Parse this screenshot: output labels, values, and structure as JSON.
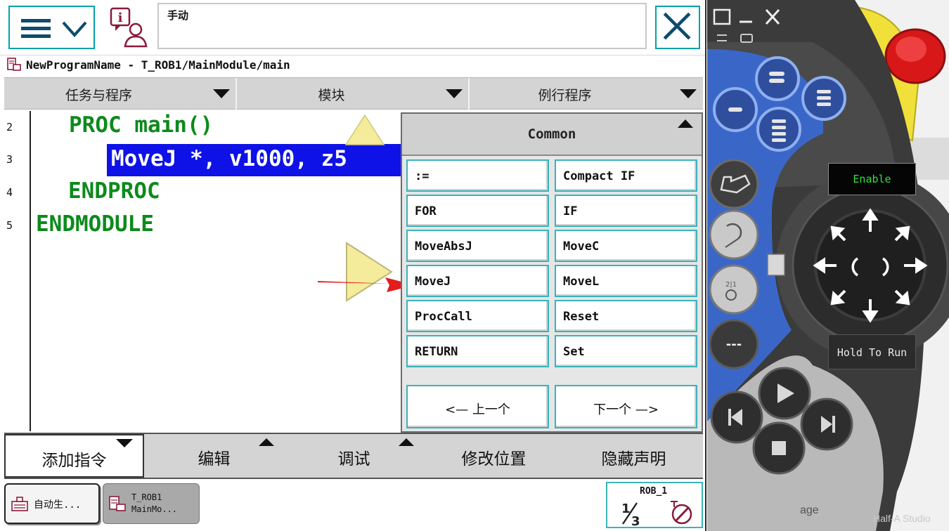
{
  "topbar": {
    "mode": "手动",
    "menu_icon": "hamburger-menu-icon",
    "info_icon": "info-person-icon",
    "close_icon": "close-icon"
  },
  "path": {
    "text": "NewProgramName - T_ROB1/MainModule/main",
    "icon": "program-icon"
  },
  "navtabs": [
    {
      "label": "任务与程序"
    },
    {
      "label": "模块"
    },
    {
      "label": "例行程序"
    }
  ],
  "editor": {
    "lines": [
      {
        "num": "2",
        "code": "PROC main()"
      },
      {
        "num": "3",
        "code": "MoveJ *, v1000, z5"
      },
      {
        "num": "4",
        "code": "ENDPROC"
      },
      {
        "num": "5",
        "code": "ENDMODULE"
      }
    ]
  },
  "popup": {
    "title": "Common",
    "commands": [
      ":=",
      "Compact IF",
      "FOR",
      "IF",
      "MoveAbsJ",
      "MoveC",
      "MoveJ",
      "MoveL",
      "ProcCall",
      "Reset",
      "RETURN",
      "Set"
    ],
    "prev": "<—  上一个",
    "next": "下一个  —>"
  },
  "bottombar": {
    "tabs": [
      "添加指令",
      "编辑",
      "调试",
      "修改位置",
      "隐藏声明"
    ]
  },
  "taskbar": {
    "task1": "自动生...",
    "task2": "T_ROB1\nMainMo...",
    "rob_label": "ROB_1",
    "rob_fraction_icon": "one-third-icon",
    "rob_speed_icon": "speed-icon"
  },
  "hardware": {
    "enable": "Enable",
    "hold_to_run": "Hold To Run",
    "bg_text_1": "age",
    "bg_text_2": "Half-A Studio",
    "colors": {
      "blue": "#3a67c7",
      "yellow": "#f2e03a",
      "red": "#d81818",
      "body": "#3b3b3b"
    }
  },
  "colors": {
    "accent": "#00a2a8",
    "code_green": "#0d8a1c",
    "selection_blue": "#0e12e6",
    "arrow_red": "#e51c1c",
    "marker_yellow": "#f4ec9a"
  }
}
